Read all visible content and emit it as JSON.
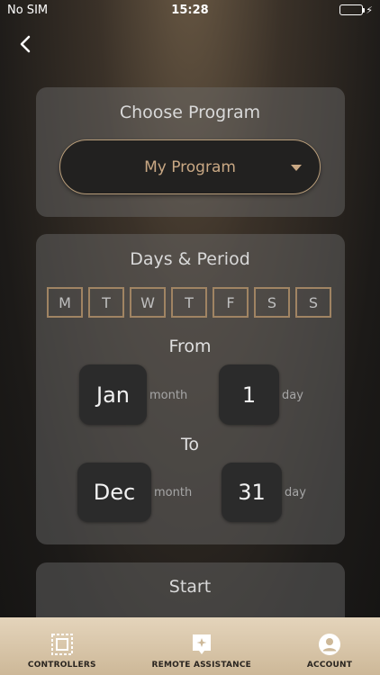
{
  "status": {
    "carrier": "No SIM",
    "time": "15:28"
  },
  "program": {
    "title": "Choose Program",
    "selected": "My Program"
  },
  "period": {
    "title": "Days & Period",
    "days": [
      "M",
      "T",
      "W",
      "T",
      "F",
      "S",
      "S"
    ],
    "from_label": "From",
    "from_month": "Jan",
    "from_day": "1",
    "to_label": "To",
    "to_month": "Dec",
    "to_day": "31",
    "month_unit": "month",
    "day_unit": "day"
  },
  "start": {
    "title": "Start"
  },
  "tabs": [
    {
      "label": "CONTROLLERS",
      "icon": "controllers-icon"
    },
    {
      "label": "REMOTE ASSISTANCE",
      "icon": "remote-assistance-icon"
    },
    {
      "label": "ACCOUNT",
      "icon": "account-icon"
    }
  ]
}
